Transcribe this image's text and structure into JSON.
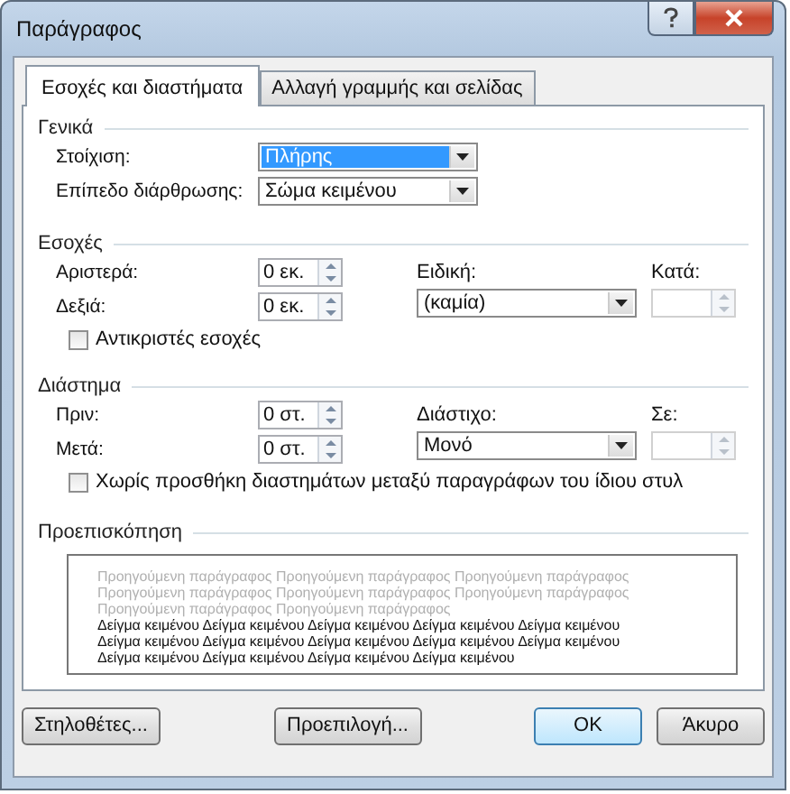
{
  "window": {
    "title": "Παράγραφος"
  },
  "tabs": [
    {
      "label": "Εσοχές και διαστήματα",
      "selected": true
    },
    {
      "label": "Αλλαγή γραμμής και σελίδας",
      "selected": false
    }
  ],
  "general": {
    "title": "Γενικά",
    "fields": [
      {
        "label": "Στοίχιση:",
        "value": "Πλήρης",
        "highlighted": true
      },
      {
        "label": "Επίπεδο διάρθρωσης:",
        "value": "Σώμα κειμένου",
        "highlighted": false
      }
    ]
  },
  "indentation": {
    "title": "Εσοχές",
    "spinners": [
      {
        "label": "Αριστερά:",
        "value": "0 εκ."
      },
      {
        "label": "Δεξιά:",
        "value": "0 εκ."
      }
    ],
    "special": {
      "label": "Ειδική:",
      "value": "(καμία)"
    },
    "by": {
      "label": "Κατά:",
      "disabled": true
    },
    "checkbox": {
      "label": "Αντικριστές εσοχές",
      "checked": false
    }
  },
  "spacing": {
    "title": "Διάστημα",
    "spinners": [
      {
        "label": "Πριν:",
        "value": "0 στ."
      },
      {
        "label": "Μετά:",
        "value": "0 στ."
      }
    ],
    "special": {
      "label": "Διάστιχο:",
      "value": "Μονό"
    },
    "by": {
      "label": "Σε:",
      "disabled": true
    },
    "checkbox": {
      "label": "Χωρίς προσθήκη διαστημάτων μεταξύ παραγράφων του ίδιου στυλ",
      "checked": false
    }
  },
  "preview": {
    "title": "Προεπισκόπηση",
    "lines": [
      {
        "kind": "previous",
        "text": "Προηγούμενη παράγραφος Προηγούμενη παράγραφος Προηγούμενη παράγραφος"
      },
      {
        "kind": "previous",
        "text": "Προηγούμενη παράγραφος Προηγούμενη παράγραφος Προηγούμενη παράγραφος"
      },
      {
        "kind": "previous",
        "text": "Προηγούμενη παράγραφος Προηγούμενη παράγραφος"
      },
      {
        "kind": "sample",
        "text": "Δείγμα κειμένου Δείγμα κειμένου Δείγμα κειμένου Δείγμα κειμένου Δείγμα κειμένου"
      },
      {
        "kind": "sample",
        "text": "Δείγμα κειμένου Δείγμα κειμένου Δείγμα κειμένου Δείγμα κειμένου Δείγμα κειμένου"
      },
      {
        "kind": "sample",
        "text": "Δείγμα κειμένου Δείγμα κειμένου Δείγμα κειμένου Δείγμα κειμένου"
      }
    ]
  },
  "buttons": [
    {
      "label": "Στηλοθέτες...",
      "kind": "left"
    },
    {
      "label": "Προεπιλογή...",
      "kind": "center"
    },
    {
      "label": "OK",
      "kind": "default"
    },
    {
      "label": "Άκυρο",
      "kind": "normal"
    }
  ]
}
